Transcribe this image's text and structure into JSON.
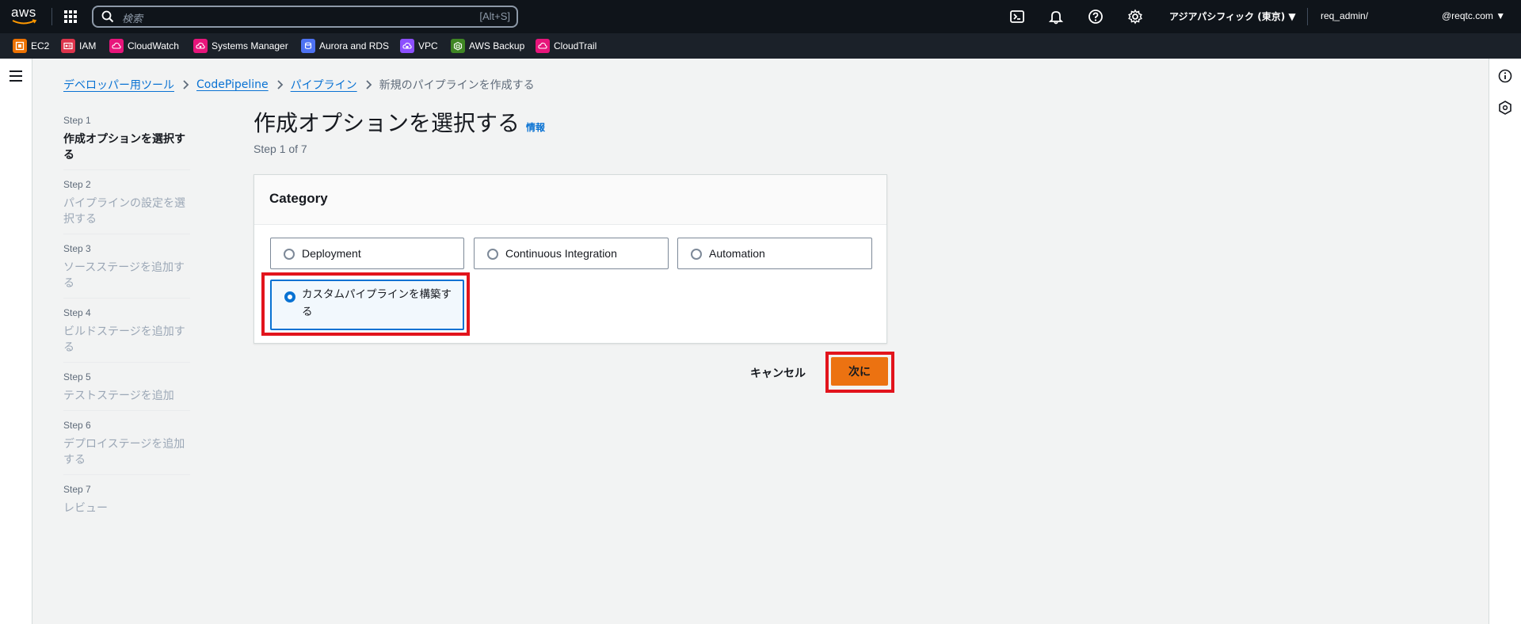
{
  "topbar": {
    "logo": "aws",
    "search_placeholder": "検索",
    "search_shortcut": "[Alt+S]",
    "region": "アジアパシフィック (東京) ▼",
    "user": "req_admin/",
    "account": "@reqtc.com ▼",
    "icons": [
      "cloudshell-icon",
      "bell-icon",
      "help-icon",
      "gear-icon"
    ]
  },
  "favorites": [
    {
      "label": "EC2",
      "color": "#ed7100"
    },
    {
      "label": "IAM",
      "color": "#dd344c"
    },
    {
      "label": "CloudWatch",
      "color": "#e7157b"
    },
    {
      "label": "Systems Manager",
      "color": "#e7157b"
    },
    {
      "label": "Aurora and RDS",
      "color": "#4d72f3"
    },
    {
      "label": "VPC",
      "color": "#8c4fff"
    },
    {
      "label": "AWS Backup",
      "color": "#3f8624"
    },
    {
      "label": "CloudTrail",
      "color": "#e7157b"
    }
  ],
  "breadcrumb": {
    "items": [
      "デベロッパー用ツール",
      "CodePipeline",
      "パイプライン"
    ],
    "current": "新規のパイプラインを作成する"
  },
  "steps": [
    {
      "label": "Step 1",
      "name": "作成オプションを選択する",
      "active": true
    },
    {
      "label": "Step 2",
      "name": "パイプラインの設定を選択する",
      "active": false
    },
    {
      "label": "Step 3",
      "name": "ソースステージを追加する",
      "active": false
    },
    {
      "label": "Step 4",
      "name": "ビルドステージを追加する",
      "active": false
    },
    {
      "label": "Step 5",
      "name": "テストステージを追加",
      "active": false
    },
    {
      "label": "Step 6",
      "name": "デプロイステージを追加する",
      "active": false
    },
    {
      "label": "Step 7",
      "name": "レビュー",
      "active": false
    }
  ],
  "main": {
    "title": "作成オプションを選択する",
    "info": "情報",
    "subtitle": "Step 1 of 7",
    "category": {
      "title": "Category",
      "options": [
        {
          "label": "Deployment",
          "selected": false
        },
        {
          "label": "Continuous Integration",
          "selected": false
        },
        {
          "label": "Automation",
          "selected": false
        },
        {
          "label": "カスタムパイプラインを構築する",
          "selected": true
        }
      ]
    }
  },
  "actions": {
    "cancel": "キャンセル",
    "next": "次に"
  },
  "colors": {
    "accent": "#0972d3",
    "primary_button": "#ec7211",
    "highlight": "#e2141c"
  }
}
